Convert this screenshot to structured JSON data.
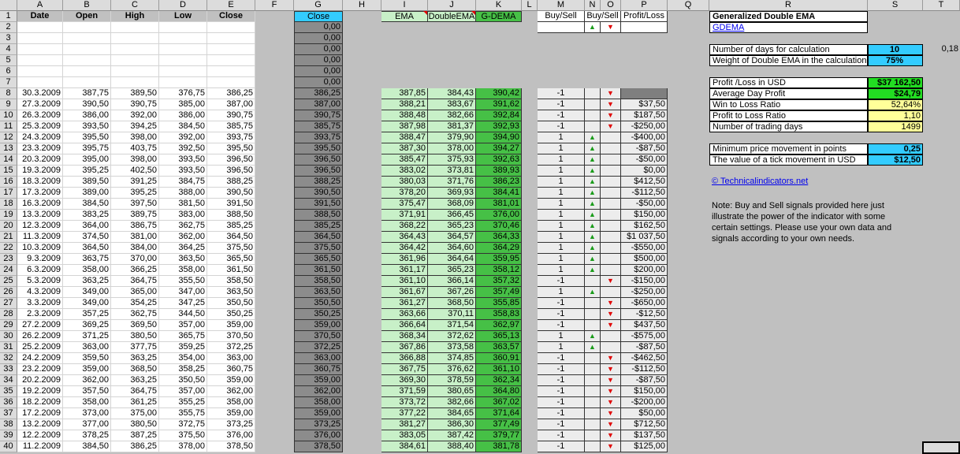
{
  "columns": [
    "A",
    "B",
    "C",
    "D",
    "E",
    "F",
    "G",
    "H",
    "I",
    "J",
    "K",
    "L",
    "M",
    "N",
    "O",
    "P",
    "Q",
    "R",
    "S",
    "T"
  ],
  "headers": {
    "date": "Date",
    "open": "Open",
    "high": "High",
    "low": "Low",
    "close": "Close",
    "g_close": "Close",
    "ema": "EMA",
    "double_ema": "DoubleEMA",
    "gdema": "G-DEMA",
    "buy_sell_m": "Buy/Sell",
    "buy_sell_no": "Buy/Sell",
    "profit_loss": "Profit/Loss"
  },
  "g_leading_zeros": [
    "0,00",
    "0,00",
    "0,00",
    "0,00",
    "0,00",
    "0,00"
  ],
  "rows": [
    {
      "date": "30.3.2009",
      "open": "387,75",
      "high": "389,50",
      "low": "376,75",
      "close": "386,25",
      "g": "386,25",
      "ema": "387,85",
      "dema": "384,43",
      "gdema": "390,42",
      "signal": "-1",
      "arrow": "down",
      "pl": ""
    },
    {
      "date": "27.3.2009",
      "open": "390,50",
      "high": "390,75",
      "low": "385,00",
      "close": "387,00",
      "g": "387,00",
      "ema": "388,21",
      "dema": "383,67",
      "gdema": "391,62",
      "signal": "-1",
      "arrow": "down",
      "pl": "$37,50"
    },
    {
      "date": "26.3.2009",
      "open": "386,00",
      "high": "392,00",
      "low": "386,00",
      "close": "390,75",
      "g": "390,75",
      "ema": "388,48",
      "dema": "382,66",
      "gdema": "392,84",
      "signal": "-1",
      "arrow": "down",
      "pl": "$187,50"
    },
    {
      "date": "25.3.2009",
      "open": "393,50",
      "high": "394,25",
      "low": "384,50",
      "close": "385,75",
      "g": "385,75",
      "ema": "387,98",
      "dema": "381,37",
      "gdema": "392,93",
      "signal": "-1",
      "arrow": "down",
      "pl": "-$250,00"
    },
    {
      "date": "24.3.2009",
      "open": "395,50",
      "high": "398,00",
      "low": "392,00",
      "close": "393,75",
      "g": "393,75",
      "ema": "388,47",
      "dema": "379,90",
      "gdema": "394,90",
      "signal": "1",
      "arrow": "up",
      "pl": "-$400,00"
    },
    {
      "date": "23.3.2009",
      "open": "395,75",
      "high": "403,75",
      "low": "392,50",
      "close": "395,50",
      "g": "395,50",
      "ema": "387,30",
      "dema": "378,00",
      "gdema": "394,27",
      "signal": "1",
      "arrow": "up",
      "pl": "-$87,50"
    },
    {
      "date": "20.3.2009",
      "open": "395,00",
      "high": "398,00",
      "low": "393,50",
      "close": "396,50",
      "g": "396,50",
      "ema": "385,47",
      "dema": "375,93",
      "gdema": "392,63",
      "signal": "1",
      "arrow": "up",
      "pl": "-$50,00"
    },
    {
      "date": "19.3.2009",
      "open": "395,25",
      "high": "402,50",
      "low": "393,50",
      "close": "396,50",
      "g": "396,50",
      "ema": "383,02",
      "dema": "373,81",
      "gdema": "389,93",
      "signal": "1",
      "arrow": "up",
      "pl": "$0,00"
    },
    {
      "date": "18.3.2009",
      "open": "389,50",
      "high": "391,25",
      "low": "384,75",
      "close": "388,25",
      "g": "388,25",
      "ema": "380,03",
      "dema": "371,76",
      "gdema": "386,23",
      "signal": "1",
      "arrow": "up",
      "pl": "$412,50"
    },
    {
      "date": "17.3.2009",
      "open": "389,00",
      "high": "395,25",
      "low": "388,00",
      "close": "390,50",
      "g": "390,50",
      "ema": "378,20",
      "dema": "369,93",
      "gdema": "384,41",
      "signal": "1",
      "arrow": "up",
      "pl": "-$112,50"
    },
    {
      "date": "16.3.2009",
      "open": "384,50",
      "high": "397,50",
      "low": "381,50",
      "close": "391,50",
      "g": "391,50",
      "ema": "375,47",
      "dema": "368,09",
      "gdema": "381,01",
      "signal": "1",
      "arrow": "up",
      "pl": "-$50,00"
    },
    {
      "date": "13.3.2009",
      "open": "383,25",
      "high": "389,75",
      "low": "383,00",
      "close": "388,50",
      "g": "388,50",
      "ema": "371,91",
      "dema": "366,45",
      "gdema": "376,00",
      "signal": "1",
      "arrow": "up",
      "pl": "$150,00"
    },
    {
      "date": "12.3.2009",
      "open": "364,00",
      "high": "386,75",
      "low": "362,75",
      "close": "385,25",
      "g": "385,25",
      "ema": "368,22",
      "dema": "365,23",
      "gdema": "370,46",
      "signal": "1",
      "arrow": "up",
      "pl": "$162,50"
    },
    {
      "date": "11.3.2009",
      "open": "374,50",
      "high": "381,00",
      "low": "362,00",
      "close": "364,50",
      "g": "364,50",
      "ema": "364,43",
      "dema": "364,57",
      "gdema": "364,33",
      "signal": "1",
      "arrow": "up",
      "pl": "$1 037,50"
    },
    {
      "date": "10.3.2009",
      "open": "364,50",
      "high": "384,00",
      "low": "364,25",
      "close": "375,50",
      "g": "375,50",
      "ema": "364,42",
      "dema": "364,60",
      "gdema": "364,29",
      "signal": "1",
      "arrow": "up",
      "pl": "-$550,00"
    },
    {
      "date": "9.3.2009",
      "open": "363,75",
      "high": "370,00",
      "low": "363,50",
      "close": "365,50",
      "g": "365,50",
      "ema": "361,96",
      "dema": "364,64",
      "gdema": "359,95",
      "signal": "1",
      "arrow": "up",
      "pl": "$500,00"
    },
    {
      "date": "6.3.2009",
      "open": "358,00",
      "high": "366,25",
      "low": "358,00",
      "close": "361,50",
      "g": "361,50",
      "ema": "361,17",
      "dema": "365,23",
      "gdema": "358,12",
      "signal": "1",
      "arrow": "up",
      "pl": "$200,00"
    },
    {
      "date": "5.3.2009",
      "open": "363,25",
      "high": "364,75",
      "low": "355,50",
      "close": "358,50",
      "g": "358,50",
      "ema": "361,10",
      "dema": "366,14",
      "gdema": "357,32",
      "signal": "-1",
      "arrow": "down",
      "pl": "-$150,00"
    },
    {
      "date": "4.3.2009",
      "open": "349,00",
      "high": "365,00",
      "low": "347,00",
      "close": "363,50",
      "g": "363,50",
      "ema": "361,67",
      "dema": "367,26",
      "gdema": "357,49",
      "signal": "1",
      "arrow": "up",
      "pl": "-$250,00"
    },
    {
      "date": "3.3.2009",
      "open": "349,00",
      "high": "354,25",
      "low": "347,25",
      "close": "350,50",
      "g": "350,50",
      "ema": "361,27",
      "dema": "368,50",
      "gdema": "355,85",
      "signal": "-1",
      "arrow": "down",
      "pl": "-$650,00"
    },
    {
      "date": "2.3.2009",
      "open": "357,25",
      "high": "362,75",
      "low": "344,50",
      "close": "350,25",
      "g": "350,25",
      "ema": "363,66",
      "dema": "370,11",
      "gdema": "358,83",
      "signal": "-1",
      "arrow": "down",
      "pl": "-$12,50"
    },
    {
      "date": "27.2.2009",
      "open": "369,25",
      "high": "369,50",
      "low": "357,00",
      "close": "359,00",
      "g": "359,00",
      "ema": "366,64",
      "dema": "371,54",
      "gdema": "362,97",
      "signal": "-1",
      "arrow": "down",
      "pl": "$437,50"
    },
    {
      "date": "26.2.2009",
      "open": "371,25",
      "high": "380,50",
      "low": "365,75",
      "close": "370,50",
      "g": "370,50",
      "ema": "368,34",
      "dema": "372,62",
      "gdema": "365,13",
      "signal": "1",
      "arrow": "up",
      "pl": "-$575,00"
    },
    {
      "date": "25.2.2009",
      "open": "363,00",
      "high": "377,75",
      "low": "359,25",
      "close": "372,25",
      "g": "372,25",
      "ema": "367,86",
      "dema": "373,58",
      "gdema": "363,57",
      "signal": "1",
      "arrow": "up",
      "pl": "-$87,50"
    },
    {
      "date": "24.2.2009",
      "open": "359,50",
      "high": "363,25",
      "low": "354,00",
      "close": "363,00",
      "g": "363,00",
      "ema": "366,88",
      "dema": "374,85",
      "gdema": "360,91",
      "signal": "-1",
      "arrow": "down",
      "pl": "-$462,50"
    },
    {
      "date": "23.2.2009",
      "open": "359,00",
      "high": "368,50",
      "low": "358,25",
      "close": "360,75",
      "g": "360,75",
      "ema": "367,75",
      "dema": "376,62",
      "gdema": "361,10",
      "signal": "-1",
      "arrow": "down",
      "pl": "-$112,50"
    },
    {
      "date": "20.2.2009",
      "open": "362,00",
      "high": "363,25",
      "low": "350,50",
      "close": "359,00",
      "g": "359,00",
      "ema": "369,30",
      "dema": "378,59",
      "gdema": "362,34",
      "signal": "-1",
      "arrow": "down",
      "pl": "-$87,50"
    },
    {
      "date": "19.2.2009",
      "open": "357,50",
      "high": "364,75",
      "low": "357,00",
      "close": "362,00",
      "g": "362,00",
      "ema": "371,59",
      "dema": "380,65",
      "gdema": "364,80",
      "signal": "-1",
      "arrow": "down",
      "pl": "$150,00"
    },
    {
      "date": "18.2.2009",
      "open": "358,00",
      "high": "361,25",
      "low": "355,25",
      "close": "358,00",
      "g": "358,00",
      "ema": "373,72",
      "dema": "382,66",
      "gdema": "367,02",
      "signal": "-1",
      "arrow": "down",
      "pl": "-$200,00"
    },
    {
      "date": "17.2.2009",
      "open": "373,00",
      "high": "375,00",
      "low": "355,75",
      "close": "359,00",
      "g": "359,00",
      "ema": "377,22",
      "dema": "384,65",
      "gdema": "371,64",
      "signal": "-1",
      "arrow": "down",
      "pl": "$50,00"
    },
    {
      "date": "13.2.2009",
      "open": "377,00",
      "high": "380,50",
      "low": "372,75",
      "close": "373,25",
      "g": "373,25",
      "ema": "381,27",
      "dema": "386,30",
      "gdema": "377,49",
      "signal": "-1",
      "arrow": "down",
      "pl": "$712,50"
    },
    {
      "date": "12.2.2009",
      "open": "378,25",
      "high": "387,25",
      "low": "375,50",
      "close": "376,00",
      "g": "376,00",
      "ema": "383,05",
      "dema": "387,42",
      "gdema": "379,77",
      "signal": "-1",
      "arrow": "down",
      "pl": "$137,50"
    },
    {
      "date": "11.2.2009",
      "open": "384,50",
      "high": "386,25",
      "low": "378,00",
      "close": "378,50",
      "g": "378,50",
      "ema": "384,61",
      "dema": "388,40",
      "gdema": "381,78",
      "signal": "-1",
      "arrow": "down",
      "pl": "$125,00"
    }
  ],
  "panel": {
    "title": "Generalized Double EMA",
    "link": "GDEMA",
    "days_label": "Number of days for calculation",
    "days_value": "10",
    "side_value": "0,18",
    "weight_label": "Weight of Double EMA in the calculation",
    "weight_value": "75%",
    "stats": [
      {
        "label": "Profit /Loss in USD",
        "value": "$37 162,50",
        "style": "grn"
      },
      {
        "label": "Average Day Profit",
        "value": "$24,79",
        "style": "grn"
      },
      {
        "label": "Win to Loss Ratio",
        "value": "52,64%",
        "style": "yel"
      },
      {
        "label": "Profit to Loss Ratio",
        "value": "1,10",
        "style": "yel"
      },
      {
        "label": "Number of trading days",
        "value": "1499",
        "style": "yel"
      }
    ],
    "min_move_label": "Minimum price movement in points",
    "min_move_value": "0,25",
    "tick_label": "The value of a tick movement in USD",
    "tick_value": "$12,50",
    "site_link": "© Technicalindicators.net",
    "note": "Note: Buy and Sell signals provided here just illustrate the power of the indicator with some certain settings. Please use your own data and signals according to your own needs."
  },
  "colors": {
    "grid_bg": "#c0c0c0",
    "header_bg": "#dcdcdc",
    "gdema_green": "#46c046",
    "ema_green": "#c8f0c8",
    "cyan": "#33ccff",
    "up_arrow": "#1a9c1a",
    "down_arrow": "#e00000"
  }
}
